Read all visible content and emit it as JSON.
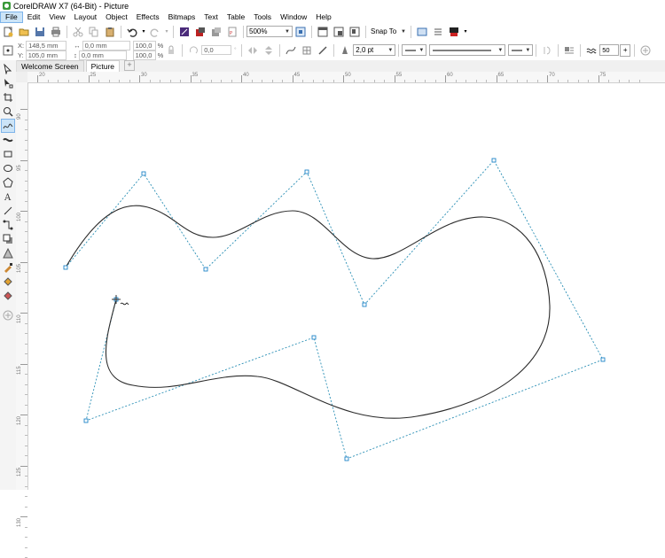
{
  "app": {
    "title": "CorelDRAW X7 (64-Bit) - Picture"
  },
  "menu": [
    {
      "label": "File",
      "active": true
    },
    {
      "label": "Edit"
    },
    {
      "label": "View"
    },
    {
      "label": "Layout"
    },
    {
      "label": "Object"
    },
    {
      "label": "Effects"
    },
    {
      "label": "Bitmaps"
    },
    {
      "label": "Text"
    },
    {
      "label": "Table"
    },
    {
      "label": "Tools"
    },
    {
      "label": "Window"
    },
    {
      "label": "Help"
    }
  ],
  "standard_toolbar": {
    "zoom_value": "500%",
    "snap_to_label": "Snap To"
  },
  "property_bar": {
    "x_label": "X:",
    "x_value": "148,5 mm",
    "y_label": "Y:",
    "y_value": "105,0 mm",
    "w_value": "0,0 mm",
    "h_value": "0,0 mm",
    "scale_w": "100,0",
    "scale_h": "100,0",
    "scale_unit": "%",
    "rotation_value": "0,0",
    "outline_width": "2,0 pt",
    "smoothing_value": "50"
  },
  "tabs": [
    {
      "label": "Welcome Screen"
    },
    {
      "label": "Picture",
      "active": true
    }
  ],
  "rulers": {
    "horizontal": [
      "20",
      "25",
      "30",
      "35",
      "40",
      "45",
      "50",
      "55",
      "60",
      "65",
      "70",
      "75"
    ],
    "vertical": [
      "90",
      "95",
      "100",
      "105",
      "110",
      "115",
      "120",
      "125",
      "130"
    ]
  },
  "colors": {
    "selection_accent": "#1e84c8",
    "control_line": "#2a8fb5",
    "curve": "#2b2b2b"
  }
}
